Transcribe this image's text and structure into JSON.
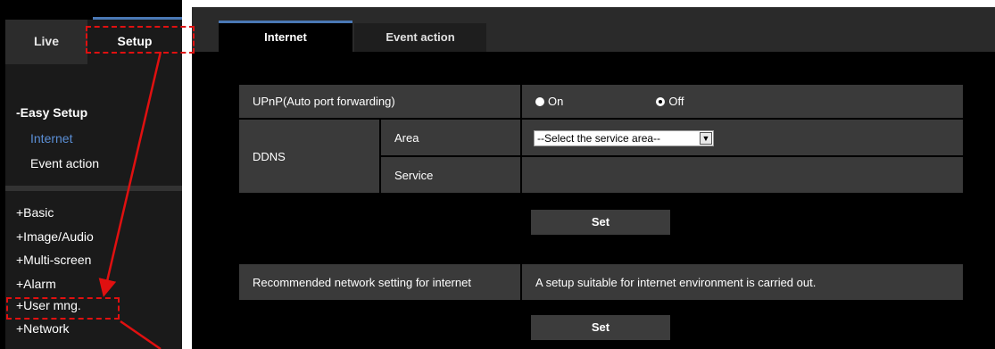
{
  "sidebar": {
    "tabs": {
      "live": "Live",
      "setup": "Setup"
    },
    "easy_setup": {
      "heading": "-Easy Setup",
      "internet": "Internet",
      "event_action": "Event action"
    },
    "menu": [
      "+Basic",
      "+Image/Audio",
      "+Multi-screen",
      "+Alarm",
      "+User mng.",
      "+Network"
    ]
  },
  "main": {
    "tabs": {
      "internet": "Internet",
      "event_action": "Event action"
    },
    "upnp": {
      "label": "UPnP(Auto port forwarding)",
      "on": "On",
      "off": "Off",
      "selected": "Off"
    },
    "ddns": {
      "label": "DDNS",
      "area_label": "Area",
      "area_value": "--Select the service area--",
      "service_label": "Service",
      "service_value": ""
    },
    "set_button_1": "Set",
    "recommended": {
      "label": "Recommended network setting for internet",
      "description": "A setup suitable for internet environment is carried out."
    },
    "set_button_2": "Set"
  },
  "colors": {
    "accent": "#4a78b5",
    "active_link": "#5b8fd6",
    "annotation": "#e01010"
  }
}
